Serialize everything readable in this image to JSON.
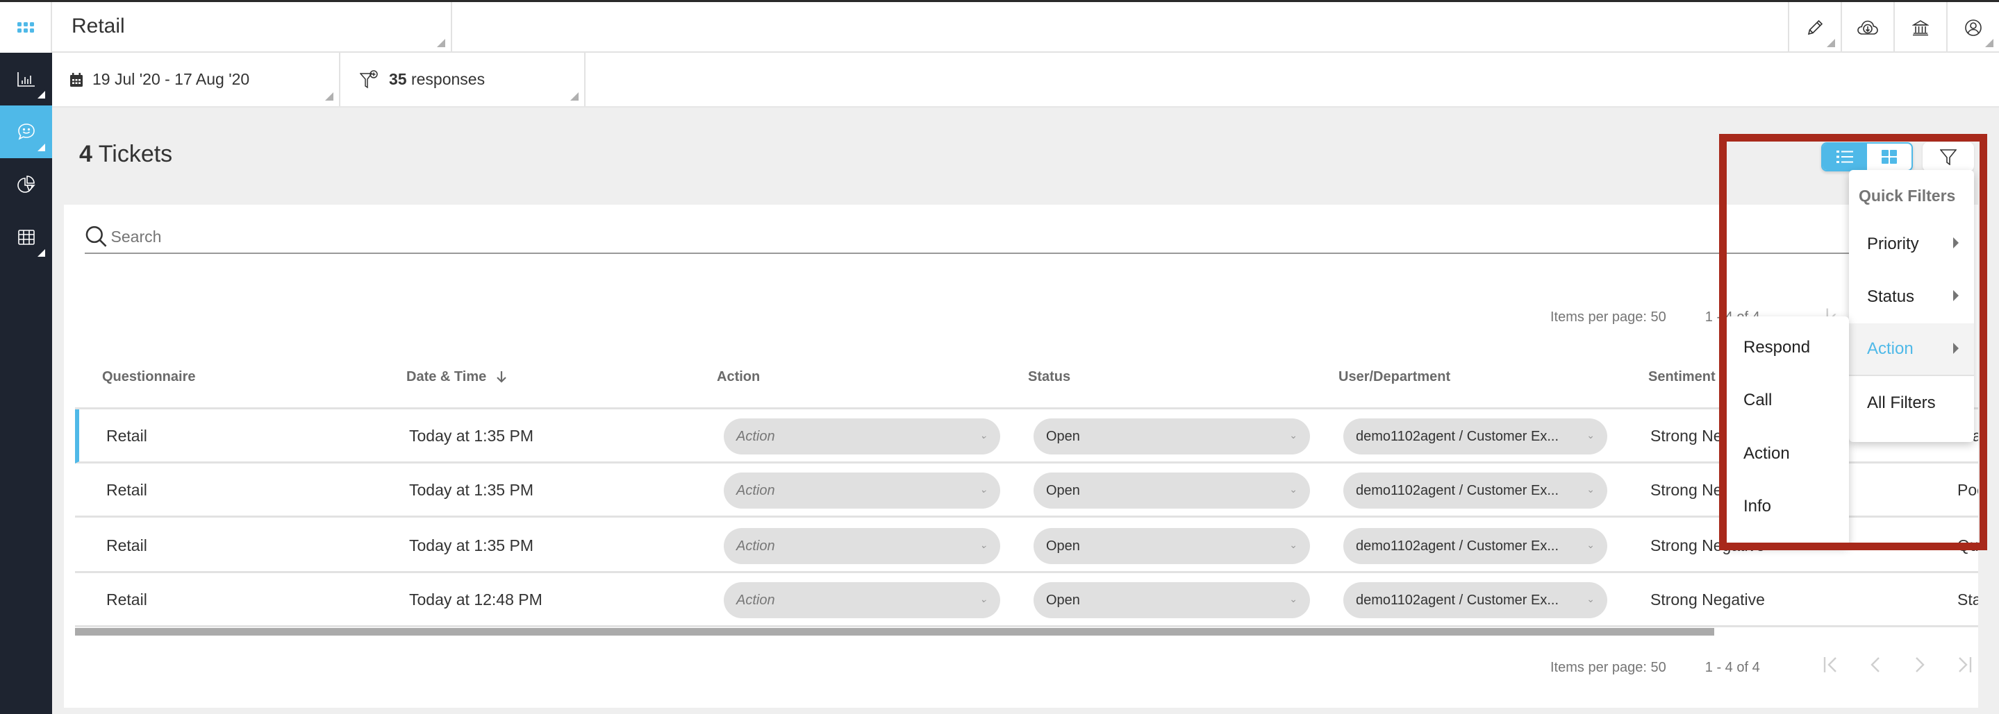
{
  "app": {
    "title": "Retail",
    "launcher_icon": "app-grid-icon"
  },
  "sidebar": {
    "items": [
      {
        "name": "analytics",
        "icon": "bar-chart-icon",
        "active": false,
        "has_submenu": true
      },
      {
        "name": "tickets",
        "icon": "chat-smile-icon",
        "active": true,
        "has_submenu": true
      },
      {
        "name": "reports",
        "icon": "pie-chart-icon",
        "active": false,
        "has_submenu": false
      },
      {
        "name": "data-table",
        "icon": "table-grid-icon",
        "active": false,
        "has_submenu": true
      }
    ]
  },
  "topbar": {
    "icons": [
      "pencil-icon",
      "cloud-download-icon",
      "bank-icon",
      "user-circle-icon"
    ]
  },
  "subbar": {
    "date_range": "19 Jul '20 - 17 Aug '20",
    "responses_count": "35",
    "responses_label": "responses"
  },
  "tickets": {
    "count": "4",
    "label": "Tickets"
  },
  "search": {
    "placeholder": "Search",
    "value": ""
  },
  "pagination": {
    "items_per_page_label": "Items per page:",
    "items_per_page": "50",
    "range": "1 - 4 of 4"
  },
  "table": {
    "columns": [
      "Questionnaire",
      "Date & Time",
      "Action",
      "Status",
      "User/Department",
      "Sentiment",
      ""
    ],
    "sort_column": "Date & Time",
    "sort_direction": "desc",
    "rows": [
      {
        "questionnaire": "Retail",
        "datetime": "Today at 1:35 PM",
        "action": "Action",
        "status": "Open",
        "user": "demo1102agent / Customer Ex...",
        "sentiment": "Strong Negative",
        "extra": "Sta",
        "selected": true
      },
      {
        "questionnaire": "Retail",
        "datetime": "Today at 1:35 PM",
        "action": "Action",
        "status": "Open",
        "user": "demo1102agent / Customer Ex...",
        "sentiment": "Strong Negative",
        "extra": "Poo",
        "selected": false
      },
      {
        "questionnaire": "Retail",
        "datetime": "Today at 1:35 PM",
        "action": "Action",
        "status": "Open",
        "user": "demo1102agent / Customer Ex...",
        "sentiment": "Strong Negative",
        "extra": "Qu",
        "selected": false
      },
      {
        "questionnaire": "Retail",
        "datetime": "Today at 12:48 PM",
        "action": "Action",
        "status": "Open",
        "user": "demo1102agent / Customer Ex...",
        "sentiment": "Strong Negative",
        "extra": "Sta",
        "selected": false
      }
    ]
  },
  "view_toggle": {
    "options": [
      "list-view",
      "grid-view"
    ],
    "selected": "list-view"
  },
  "quick_filters": {
    "title": "Quick Filters",
    "items": [
      {
        "label": "Priority",
        "has_submenu": true,
        "active": false
      },
      {
        "label": "Status",
        "has_submenu": true,
        "active": false
      },
      {
        "label": "Action",
        "has_submenu": true,
        "active": true
      },
      {
        "label": "All Filters",
        "has_submenu": false,
        "active": false
      }
    ],
    "action_submenu": [
      "Respond",
      "Call",
      "Action",
      "Info"
    ]
  },
  "colors": {
    "accent": "#4fb9e8",
    "sidebar_bg": "#1e2430",
    "highlight_box": "#a8291b",
    "pill_bg": "#e0e0e0"
  }
}
